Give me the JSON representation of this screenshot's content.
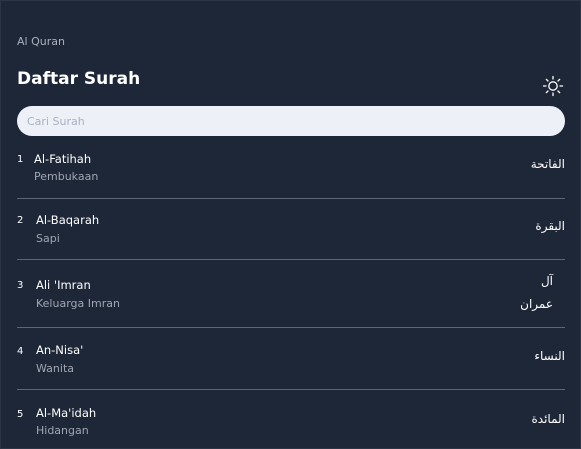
{
  "header": {
    "app_title": "Al Quran",
    "page_title": "Daftar Surah",
    "theme_icon": "sun-icon"
  },
  "search": {
    "placeholder": "Cari Surah",
    "value": ""
  },
  "surahs": [
    {
      "number": "1",
      "name": "Al-Fatihah",
      "meaning": "Pembukaan",
      "arabic": "الفاتحة"
    },
    {
      "number": "2",
      "name": "Al-Baqarah",
      "meaning": "Sapi",
      "arabic": "البقرة"
    },
    {
      "number": "3",
      "name": "Ali 'Imran",
      "meaning": "Keluarga Imran",
      "arabic": "آل\nعمران"
    },
    {
      "number": "4",
      "name": "An-Nisa'",
      "meaning": "Wanita",
      "arabic": "النساء"
    },
    {
      "number": "5",
      "name": "Al-Ma'idah",
      "meaning": "Hidangan",
      "arabic": "المائدة"
    }
  ],
  "colors": {
    "background": "#1e2737",
    "search_background": "#edf1f7",
    "divider": "#5d6677",
    "muted_text": "#9fa7b4"
  }
}
